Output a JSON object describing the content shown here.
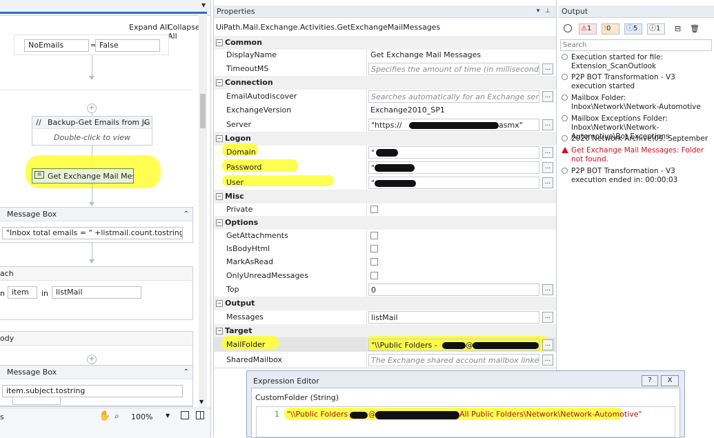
{
  "designer": {
    "expand_all": "Expand All",
    "collapse_all": "Collapse All",
    "assign": {
      "left": "NoEmails",
      "op": "=",
      "right": "False"
    },
    "backup_activity": {
      "title": "Backup-Get Emails from JG",
      "hint": "Double-click to view"
    },
    "selected_activity": "Get Exchange Mail Message",
    "message_box_1": {
      "title": "Message Box",
      "expr": "\"Inbox total emails = \" +listmail.count.tostring"
    },
    "foreach": {
      "title": "ach",
      "prefix": "n",
      "item": "item",
      "in": "in",
      "list": "listMail"
    },
    "body": {
      "title": "ody"
    },
    "message_box_2": {
      "title": "Message Box",
      "expr": "item.subject.tostring"
    },
    "zoom": "100%",
    "footer_left": "s"
  },
  "properties": {
    "pane_title": "Properties",
    "activity_type": "UiPath.Mail.Exchange.Activities.GetExchangeMailMessages",
    "categories": {
      "common": "Common",
      "connection": "Connection",
      "logon": "Logon",
      "misc": "Misc",
      "options": "Options",
      "output": "Output",
      "target": "Target"
    },
    "rows": {
      "displayname": {
        "name": "DisplayName",
        "value": "Get Exchange Mail Messages"
      },
      "timeoutms": {
        "name": "TimeoutMS",
        "placeholder": "Specifies the amount of time (in milliseconds) to wait f"
      },
      "emailautodiscover": {
        "name": "EmailAutodiscover",
        "placeholder": "Searches automatically for an Exchange server by usir"
      },
      "exchangeversion": {
        "name": "ExchangeVersion",
        "value": "Exchange2010_SP1"
      },
      "server": {
        "name": "Server",
        "value_start": "\"https://",
        "value_end": "asmx\""
      },
      "domain": {
        "name": "Domain",
        "value": "\""
      },
      "password": {
        "name": "Password",
        "value": "\""
      },
      "user": {
        "name": "User",
        "value": "\""
      },
      "private": {
        "name": "Private"
      },
      "getattachments": {
        "name": "GetAttachments"
      },
      "isbodyhtml": {
        "name": "IsBodyHtml"
      },
      "markasread": {
        "name": "MarkAsRead"
      },
      "onlyunread": {
        "name": "OnlyUnreadMessages"
      },
      "top": {
        "name": "Top",
        "value": "0"
      },
      "messages": {
        "name": "Messages",
        "value": "listMail"
      },
      "mailfolder": {
        "name": "MailFolder",
        "value_start": "\"\\\\Public Folders - ",
        "value_mid": "@"
      },
      "sharedmailbox": {
        "name": "SharedMailbox",
        "placeholder": "The Exchange shared account mailbox linked to the Ex"
      }
    },
    "ellipsis": "..."
  },
  "output": {
    "pane_title": "Output",
    "counts": {
      "errors": "1",
      "warnings": "0",
      "info": "5",
      "trace": "1"
    },
    "search_placeholder": "Search",
    "logs": [
      {
        "type": "info",
        "text": "Execution started for file: Extension_ScanOutlook"
      },
      {
        "type": "info",
        "text": "P2P BOT Transformation - V3 execution started"
      },
      {
        "type": "info",
        "text": "Mailbox Folder: Inbox\\Network\\Network-Automotive"
      },
      {
        "type": "info",
        "text": "Mailbox Exceptions Folder: Inbox\\Network\\Network-Automotive\\Bot Exceptions"
      },
      {
        "type": "info",
        "text": "2020 Network Archive\\09. September"
      },
      {
        "type": "error",
        "text": "Get Exchange Mail Messages: Folder not found."
      },
      {
        "type": "info",
        "text": "P2P BOT Transformation - V3 execution ended in: 00:00:03"
      }
    ],
    "colors": {
      "error": "#d01020",
      "highlight": "#ffff33"
    }
  },
  "expression_editor": {
    "title": "Expression Editor",
    "help": "?",
    "close": "X",
    "label": "CustomFolder (String)",
    "line_no": "1",
    "code_start": "\"\\\\Public Folders - ",
    "code_at": "@",
    "code_end": "All Public Folders\\Network\\Network-Automotive\""
  }
}
